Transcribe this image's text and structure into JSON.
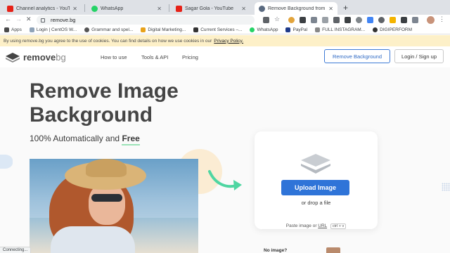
{
  "browser": {
    "tabs": [
      {
        "title": "Channel analytics - YouTube S",
        "icon_color": "#e62117",
        "active": false
      },
      {
        "title": "WhatsApp",
        "icon_color": "#25d366",
        "active": false
      },
      {
        "title": "Sagar Gola - YouTube",
        "icon_color": "#e62117",
        "active": false
      },
      {
        "title": "Remove Background from Ima",
        "icon_color": "#5a6a80",
        "active": true
      }
    ],
    "new_tab_label": "+",
    "url": "remove.bg",
    "bookmarks": [
      {
        "label": "Apps",
        "icon_color": "#4a4a4a"
      },
      {
        "label": "Login | CentOS W...",
        "icon_color": "#8fa3b8"
      },
      {
        "label": "Grammar and spel...",
        "icon_color": "#555555"
      },
      {
        "label": "Digital Marketing...",
        "icon_color": "#e8a21a"
      },
      {
        "label": "Current Services –...",
        "icon_color": "#333333"
      },
      {
        "label": "WhatsApp",
        "icon_color": "#25d366"
      },
      {
        "label": "PayPal",
        "icon_color": "#1f3a8a"
      },
      {
        "label": "FULL INSTAGRAM...",
        "icon_color": "#888888"
      },
      {
        "label": "DIGIPERFORM",
        "icon_color": "#333333"
      }
    ],
    "status_text": "Connecting..."
  },
  "cookie_banner": {
    "text": "By using remove.bg you agree to the use of cookies. You can find details on how we use cookies in our",
    "link": "Privacy Policy."
  },
  "header": {
    "logo_main": "remove",
    "logo_suffix": "bg",
    "nav": [
      "How to use",
      "Tools & API",
      "Pricing"
    ],
    "remove_button": "Remove Background",
    "login_button": "Login / Sign up"
  },
  "hero": {
    "title_line1": "Remove Image",
    "title_line2": "Background",
    "subtitle_prefix": "100% Automatically and",
    "subtitle_emphasis": "Free"
  },
  "upload": {
    "button": "Upload Image",
    "drop_text": "or drop a file",
    "paste_prefix": "Paste image or",
    "paste_url": "URL",
    "shortcut": "ctrl + v",
    "no_image": "No image?"
  },
  "colors": {
    "accent_blue": "#2f74d8",
    "arrow_green": "#4fd6a2",
    "cookie_bg": "#fdf0c8"
  }
}
